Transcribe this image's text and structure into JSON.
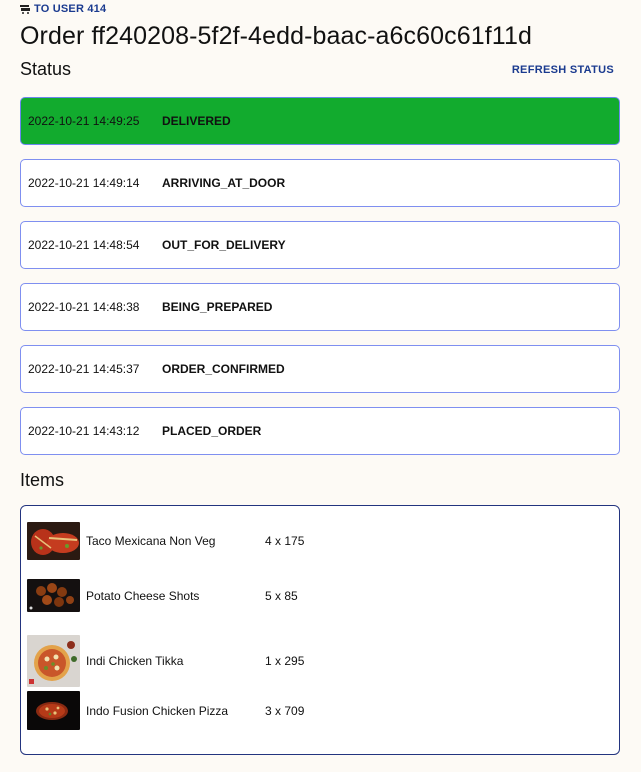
{
  "nav": {
    "back_label": "TO USER 414"
  },
  "order": {
    "title": "Order ff240208-5f2f-4edd-baac-a6c60c61f11d"
  },
  "status": {
    "heading": "Status",
    "refresh_label": "REFRESH STATUS",
    "entries": [
      {
        "time": "2022-10-21 14:49:25",
        "state": "DELIVERED"
      },
      {
        "time": "2022-10-21 14:49:14",
        "state": "ARRIVING_AT_DOOR"
      },
      {
        "time": "2022-10-21 14:48:54",
        "state": "OUT_FOR_DELIVERY"
      },
      {
        "time": "2022-10-21 14:48:38",
        "state": "BEING_PREPARED"
      },
      {
        "time": "2022-10-21 14:45:37",
        "state": "ORDER_CONFIRMED"
      },
      {
        "time": "2022-10-21 14:43:12",
        "state": "PLACED_ORDER"
      }
    ]
  },
  "items": {
    "heading": "Items",
    "list": [
      {
        "name": "Taco Mexicana Non Veg",
        "qty": "4 x 175"
      },
      {
        "name": "Potato Cheese Shots",
        "qty": "5 x 85"
      },
      {
        "name": "Indi Chicken Tikka",
        "qty": "1 x 295"
      },
      {
        "name": "Indo Fusion Chicken Pizza",
        "qty": "3 x 709"
      }
    ]
  },
  "colors": {
    "accent": "#1a3a8f",
    "delivered_bg": "#12ab2e",
    "card_border": "#7f8ff0",
    "items_border": "#23347f",
    "page_bg": "#fdfaf5"
  }
}
